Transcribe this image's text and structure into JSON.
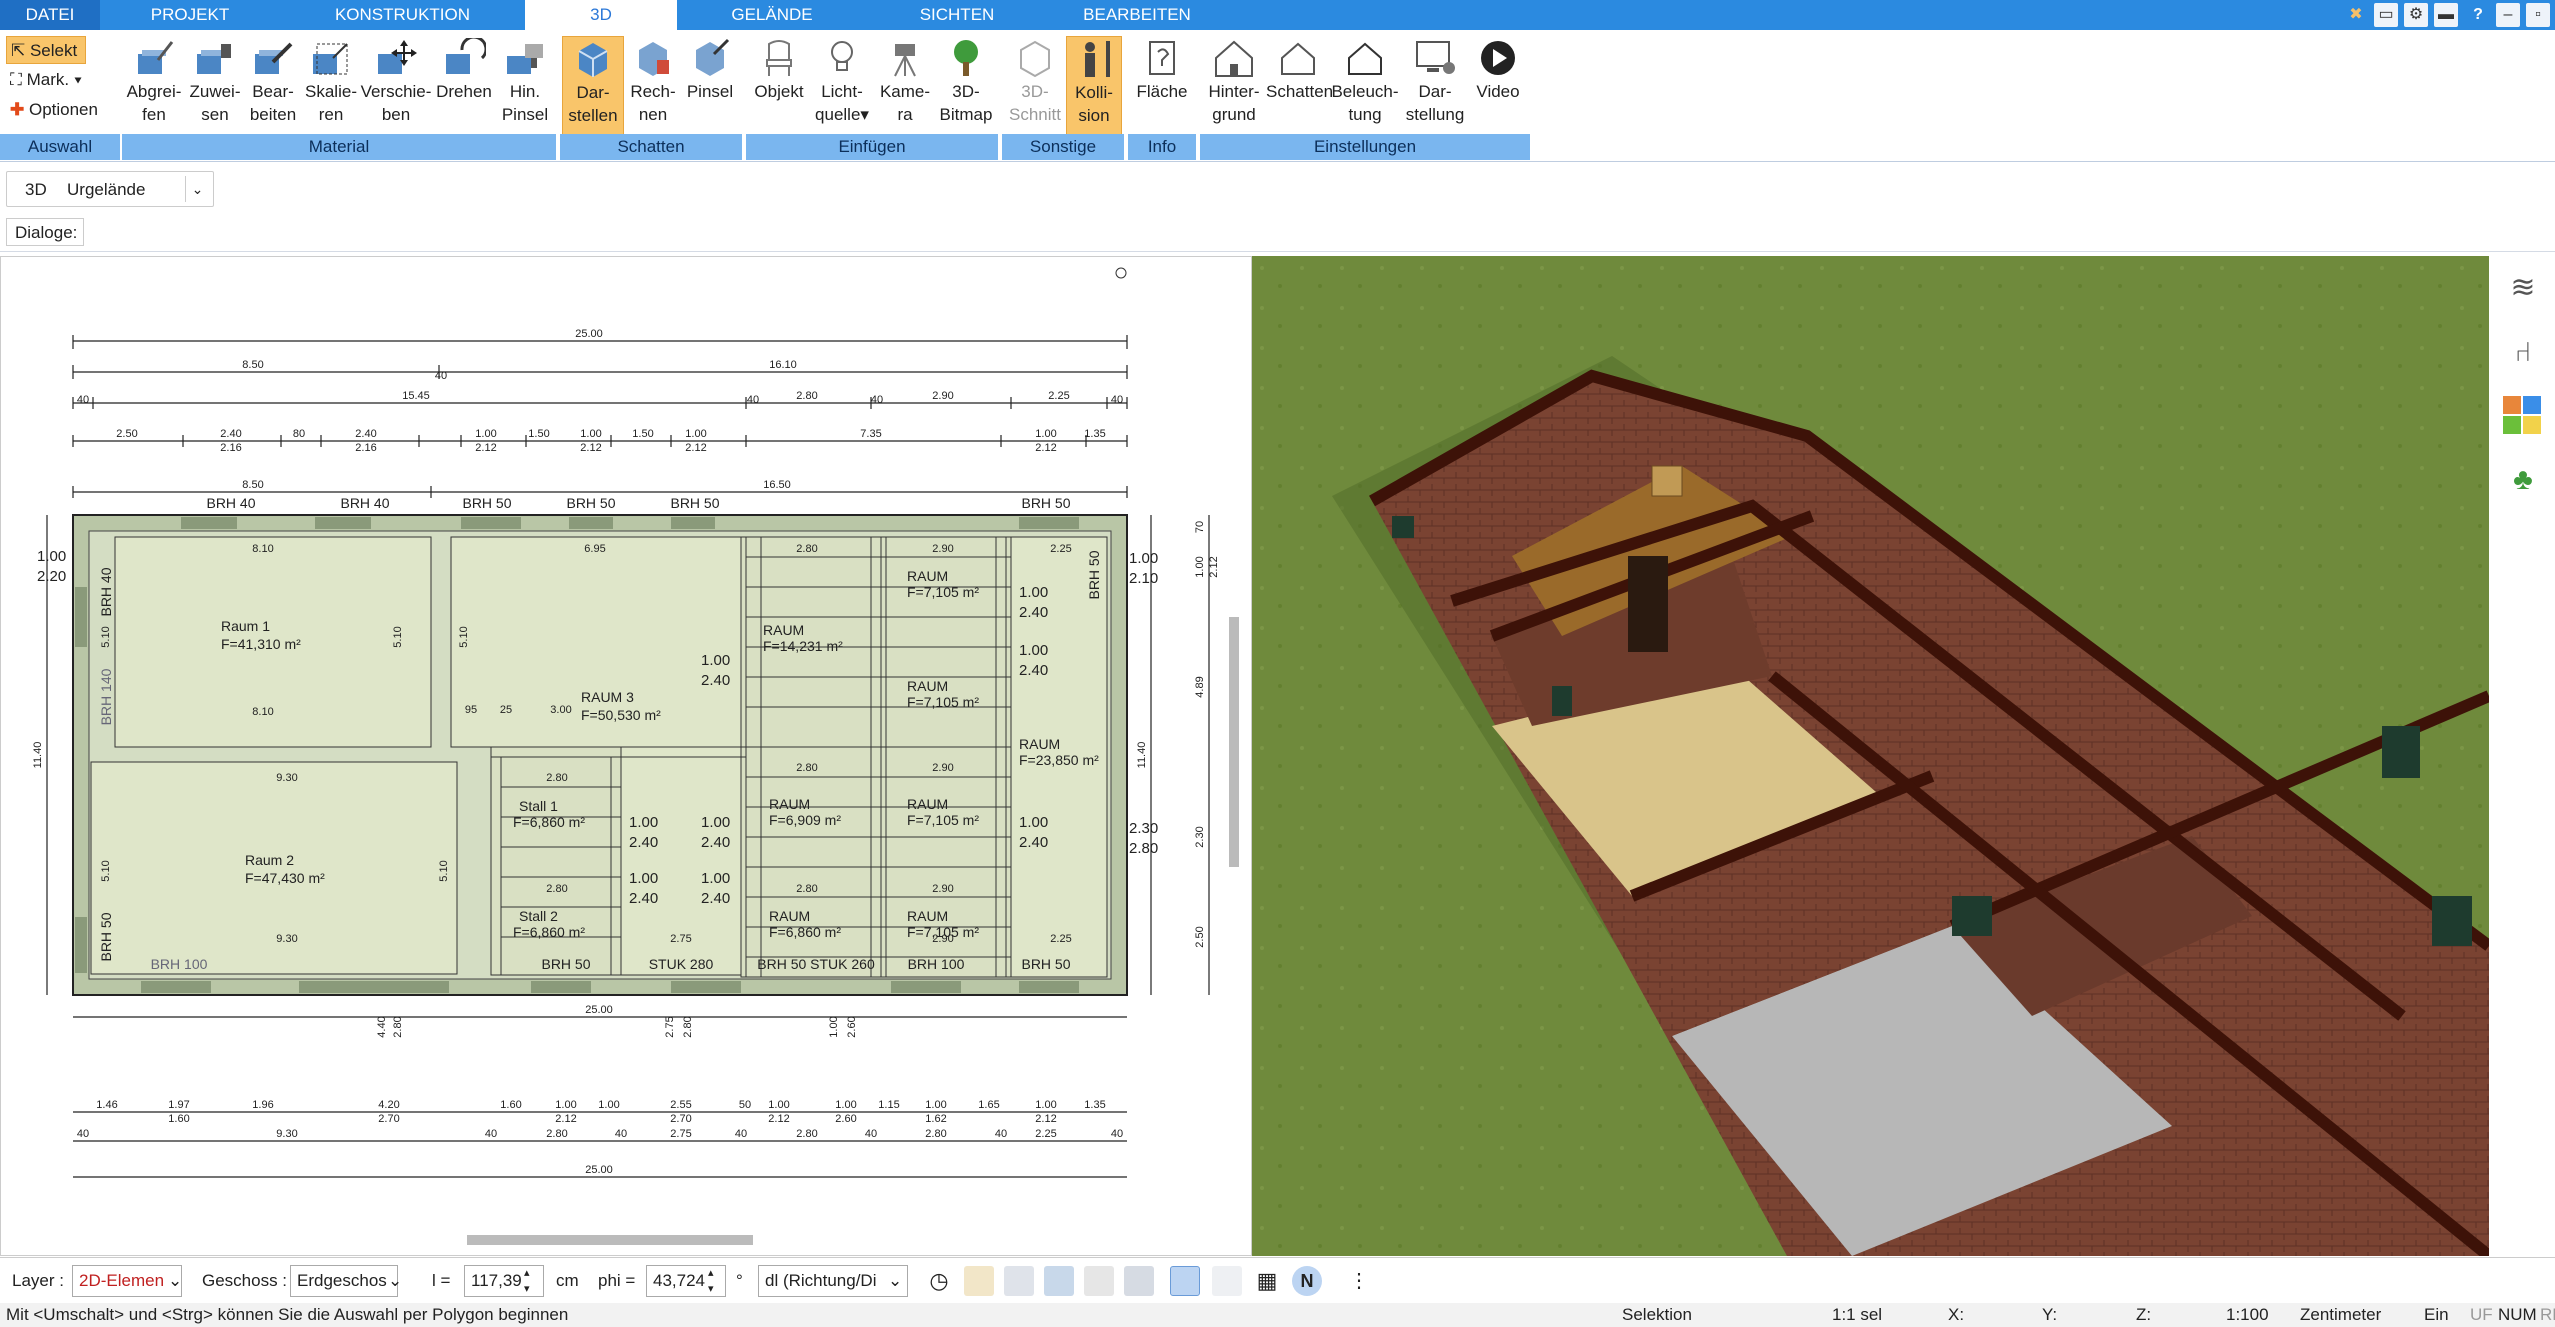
{
  "tabs": [
    {
      "label": "DATEI"
    },
    {
      "label": "PROJEKT"
    },
    {
      "label": "KONSTRUKTION"
    },
    {
      "label": "3D"
    },
    {
      "label": "GELÄNDE"
    },
    {
      "label": "SICHTEN"
    },
    {
      "label": "BEARBEITEN"
    }
  ],
  "selection": {
    "select": "Selekt",
    "mark": "Mark.",
    "options": "Optionen"
  },
  "ribbon": {
    "material": [
      {
        "l1": "Abgrei-",
        "l2": "fen"
      },
      {
        "l1": "Zuwei-",
        "l2": "sen"
      },
      {
        "l1": "Bear-",
        "l2": "beiten"
      },
      {
        "l1": "Skalie-",
        "l2": "ren"
      },
      {
        "l1": "Verschie-",
        "l2": "ben"
      },
      {
        "l1": "Drehen",
        "l2": ""
      },
      {
        "l1": "Hin.",
        "l2": "Pinsel"
      }
    ],
    "schatten": [
      {
        "l1": "Dar-",
        "l2": "stellen"
      },
      {
        "l1": "Rech-",
        "l2": "nen"
      },
      {
        "l1": "Pinsel",
        "l2": ""
      }
    ],
    "einfuegen": [
      {
        "l1": "Objekt",
        "l2": ""
      },
      {
        "l1": "Licht-",
        "l2": "quelle"
      },
      {
        "l1": "Kame-",
        "l2": "ra"
      },
      {
        "l1": "3D-",
        "l2": "Bitmap"
      }
    ],
    "sonstige": [
      {
        "l1": "3D-",
        "l2": "Schnitt"
      },
      {
        "l1": "Kolli-",
        "l2": "sion"
      }
    ],
    "info": [
      {
        "l1": "Fläche",
        "l2": ""
      }
    ],
    "einstellungen": [
      {
        "l1": "Hinter-",
        "l2": "grund"
      },
      {
        "l1": "Schatten",
        "l2": ""
      },
      {
        "l1": "Beleuch-",
        "l2": "tung"
      },
      {
        "l1": "Dar-",
        "l2": "stellung"
      },
      {
        "l1": "Video",
        "l2": ""
      }
    ],
    "groups": {
      "auswahl": "Auswahl",
      "material": "Material",
      "schatten": "Schatten",
      "einfuegen": "Einfügen",
      "sonstige": "Sonstige",
      "info": "Info",
      "einstellungen": "Einstellungen"
    }
  },
  "row2": {
    "view": "3D",
    "terrain": "Urgelände"
  },
  "row3": {
    "dialogs": "Dialoge:"
  },
  "plan": {
    "top_dims": [
      "25.00",
      "8.50",
      "16.10",
      "15.45",
      "2.80",
      "2.90",
      "2.25",
      "2.50",
      "2.40",
      "2.16",
      "80",
      "2.40",
      "2.16",
      "40",
      "1.00",
      "2.12",
      "1.50",
      "1.00",
      "2.12",
      "1.50",
      "1.00",
      "2.12",
      "7.35",
      "1.00",
      "2.12",
      "1.35",
      "40",
      "40",
      "40",
      "40",
      "40",
      "8.50",
      "16.50"
    ],
    "brh_top": [
      "BRH 40",
      "BRH 40",
      "BRH 50",
      "BRH 50",
      "BRH 50",
      "BRH 50"
    ],
    "brh_bottom": [
      "BRH 100",
      "BRH 50",
      "STUK 280",
      "BRH 50 STUK 260",
      "BRH 100",
      "BRH 50"
    ],
    "brh_side": [
      "BRH 40",
      "BRH 140",
      "BRH 50",
      "BRH 50"
    ],
    "rooms": [
      {
        "name": "Raum 1",
        "area": "F=41,310 m²"
      },
      {
        "name": "Raum 2",
        "area": "F=47,430 m²"
      },
      {
        "name": "RAUM 3",
        "area": "F=50,530 m²"
      },
      {
        "name": "RAUM",
        "area": "F=14,231 m²"
      },
      {
        "name": "RAUM",
        "area": "F=7,105 m²"
      },
      {
        "name": "RAUM",
        "area": "F=7,105 m²"
      },
      {
        "name": "RAUM",
        "area": "F=23,850 m²"
      },
      {
        "name": "Stall 1",
        "area": "F=6,860 m²"
      },
      {
        "name": "RAUM",
        "area": "F=6,909 m²"
      },
      {
        "name": "RAUM",
        "area": "F=7,105 m²"
      },
      {
        "name": "Stall 2",
        "area": "F=6,860 m²"
      },
      {
        "name": "RAUM",
        "area": "F=6,860 m²"
      },
      {
        "name": "RAUM",
        "area": "F=7,105 m²"
      }
    ],
    "inner_dims": [
      "8.10",
      "8.10",
      "5.10",
      "5.10",
      "9.30",
      "9.30",
      "5.10",
      "5.10",
      "6.95",
      "5.10",
      "2.80",
      "2.80",
      "2.90",
      "2.25",
      "2.90",
      "2.80",
      "2.80",
      "2.80",
      "2.90",
      "2.90",
      "2.75",
      "2.25",
      "95",
      "25",
      "3.00",
      "1.00",
      "2.40",
      "1.00",
      "2.40",
      "1.00",
      "2.40",
      "1.00",
      "2.40",
      "1.00",
      "2.40",
      "1.00",
      "2.40",
      "1.00",
      "2.40",
      "1.00",
      "2.40",
      "1.00",
      "2.10",
      "2.30",
      "2.80",
      "1.00",
      "2.20"
    ],
    "side_dims": [
      "11.40",
      "11.40",
      "1.00",
      "2.12",
      "4.89",
      "2.30",
      "2.50",
      "70"
    ],
    "bottom_dims_a": [
      "25.00",
      "4.40",
      "2.80",
      "2.75",
      "2.80",
      "1.00",
      "2.60"
    ],
    "bottom_dims_b": [
      "1.46",
      "1.97",
      "1.60",
      "1.96",
      "4.20",
      "2.70",
      "1.60",
      "1.00",
      "2.12",
      "1.00",
      "2.55",
      "2.70",
      "50",
      "1.00",
      "2.12",
      "1.00",
      "2.60",
      "1.15",
      "1.00",
      "1.62",
      "1.65",
      "1.00",
      "2.12",
      "1.35"
    ],
    "bottom_dims_c": [
      "40",
      "9.30",
      "40",
      "2.80",
      "40",
      "2.75",
      "40",
      "2.80",
      "40",
      "2.80",
      "40",
      "2.90",
      "40",
      "2.25",
      "40"
    ],
    "bottom_dims_d": [
      "25.00"
    ]
  },
  "bottombar": {
    "layer_label": "Layer :",
    "layer_value": "2D-Elemen",
    "geschoss_label": "Geschoss :",
    "geschoss_value": "Erdgeschos",
    "l_label": "l =",
    "l_value": "117,39",
    "l_unit": "cm",
    "phi_label": "phi =",
    "phi_value": "43,724",
    "phi_unit": "°",
    "dl_value": "dl (Richtung/Di"
  },
  "status": {
    "message": "Mit <Umschalt> und <Strg> können Sie die Auswahl per Polygon beginnen",
    "mode": "Selektion",
    "sel": "1:1 sel",
    "x": "X:",
    "y": "Y:",
    "z": "Z:",
    "scale": "1:100",
    "unit": "Zentimeter",
    "ein": "Ein",
    "uf": "UF",
    "num": "NUM",
    "rf": "RF"
  },
  "colors": {
    "accent": "#2b8ae0",
    "group_label": "#7ab6ef",
    "active_button": "#f9c56a",
    "grass": "#6f8a3c",
    "brick": "#7a4030",
    "beam": "#3d1208"
  }
}
